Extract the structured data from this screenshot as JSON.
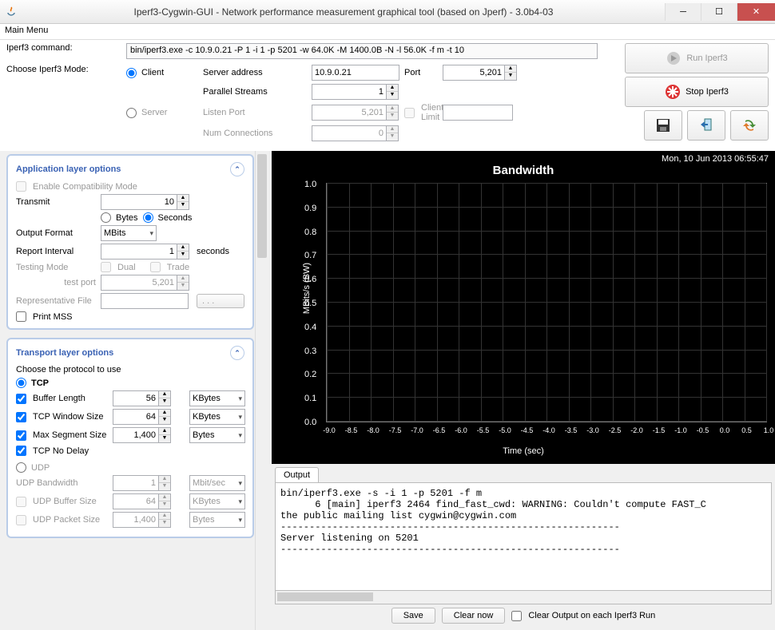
{
  "window": {
    "title": "Iperf3-Cygwin-GUI - Network performance measurement graphical tool (based on Jperf) - 3.0b4-03"
  },
  "menu": {
    "main": "Main Menu"
  },
  "top": {
    "cmd_label": "Iperf3 command:",
    "cmd_value": "bin/iperf3.exe -c 10.9.0.21 -P 1 -i 1 -p 5201 -w 64.0K -M 1400.0B -N -l 56.0K -f m -t 10",
    "mode_label": "Choose Iperf3 Mode:",
    "client": "Client",
    "server": "Server",
    "server_addr_label": "Server address",
    "server_addr": "10.9.0.21",
    "port_label": "Port",
    "port": "5,201",
    "parallel_label": "Parallel Streams",
    "parallel": "1",
    "listen_label": "Listen Port",
    "listen": "5,201",
    "climit_label": "Client Limit",
    "numconn_label": "Num Connections",
    "numconn": "0",
    "run": "Run Iperf3",
    "stop": "Stop Iperf3"
  },
  "app_layer": {
    "title": "Application layer options",
    "compat": "Enable Compatibility Mode",
    "transmit_label": "Transmit",
    "transmit": "10",
    "bytes": "Bytes",
    "seconds": "Seconds",
    "outfmt_label": "Output Format",
    "outfmt": "MBits",
    "repint_label": "Report Interval",
    "repint": "1",
    "repint_unit": "seconds",
    "testmode_label": "Testing Mode",
    "dual": "Dual",
    "trade": "Trade",
    "testport_label": "test port",
    "testport": "5,201",
    "repfile_label": "Representative File",
    "browse": ". . .",
    "printmss": "Print MSS"
  },
  "trans_layer": {
    "title": "Transport layer options",
    "protocol_label": "Choose the protocol to use",
    "tcp": "TCP",
    "buflen_label": "Buffer Length",
    "buflen": "56",
    "buflen_unit": "KBytes",
    "tcpwin_label": "TCP Window Size",
    "tcpwin": "64",
    "tcpwin_unit": "KBytes",
    "mss_label": "Max Segment Size",
    "mss": "1,400",
    "mss_unit": "Bytes",
    "nodelay": "TCP No Delay",
    "udp": "UDP",
    "udpbw_label": "UDP Bandwidth",
    "udpbw": "1",
    "udpbw_unit": "Mbit/sec",
    "udpbuf_label": "UDP Buffer Size",
    "udpbuf": "64",
    "udpbuf_unit": "KBytes",
    "udppkt_label": "UDP Packet Size",
    "udppkt": "1,400",
    "udppkt_unit": "Bytes"
  },
  "chart_data": {
    "type": "line",
    "title": "Bandwidth",
    "timestamp": "Mon, 10 Jun 2013 06:55:47",
    "xlabel": "Time (sec)",
    "ylabel": "MBits/s (BW)",
    "x_ticks": [
      -9.0,
      -8.5,
      -8.0,
      -7.5,
      -7.0,
      -6.5,
      -6.0,
      -5.5,
      -5.0,
      -4.5,
      -4.0,
      -3.5,
      -3.0,
      -2.5,
      -2.0,
      -1.5,
      -1.0,
      -0.5,
      0.0,
      0.5,
      1.0
    ],
    "y_ticks": [
      0.0,
      0.1,
      0.2,
      0.3,
      0.4,
      0.5,
      0.6,
      0.7,
      0.8,
      0.9,
      1.0
    ],
    "xlim": [
      -9.0,
      1.0
    ],
    "ylim": [
      0.0,
      1.0
    ],
    "series": []
  },
  "output": {
    "tab": "Output",
    "text": "bin/iperf3.exe -s -i 1 -p 5201 -f m\n      6 [main] iperf3 2464 find_fast_cwd: WARNING: Couldn't compute FAST_C\nthe public mailing list cygwin@cygwin.com\n-----------------------------------------------------------\nServer listening on 5201\n-----------------------------------------------------------",
    "save": "Save",
    "clear": "Clear now",
    "clear_each": "Clear Output on each Iperf3 Run"
  }
}
